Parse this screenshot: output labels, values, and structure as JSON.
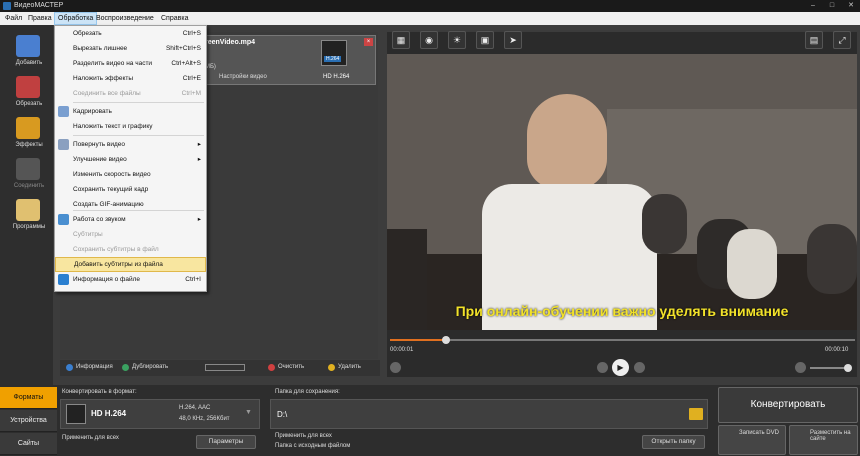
{
  "title": "ВидеоМАСТЕР",
  "menu": [
    "Файл",
    "Правка",
    "Обработка",
    "Воспроизведение",
    "Справка"
  ],
  "sidebar": [
    "Добавить",
    "Обрезать",
    "Эффекты",
    "Соединить",
    "Программы"
  ],
  "dropdown": [
    {
      "label": "Обрезать",
      "shortcut": "Ctrl+S",
      "disabled": false
    },
    {
      "label": "Вырезать лишнее",
      "shortcut": "Shift+Ctrl+S",
      "disabled": false
    },
    {
      "label": "Разделить видео на части",
      "shortcut": "Ctrl+Alt+S",
      "disabled": false
    },
    {
      "label": "Наложить эффекты",
      "shortcut": "Ctrl+E",
      "disabled": false
    },
    {
      "label": "Соединить все файлы",
      "shortcut": "Ctrl+M",
      "disabled": true
    },
    {
      "label": "Кадрировать",
      "shortcut": "",
      "disabled": false
    },
    {
      "label": "Наложить текст и графику",
      "shortcut": "",
      "disabled": false
    },
    {
      "label": "Повернуть видео",
      "shortcut": "",
      "disabled": false,
      "submenu": true
    },
    {
      "label": "Улучшение видео",
      "shortcut": "",
      "disabled": false,
      "submenu": true
    },
    {
      "label": "Изменить скорость видео",
      "shortcut": "",
      "disabled": false
    },
    {
      "label": "Сохранить текущий кадр",
      "shortcut": "",
      "disabled": false
    },
    {
      "label": "Создать GIF-анимацию",
      "shortcut": "",
      "disabled": false
    },
    {
      "label": "Работа со звуком",
      "shortcut": "",
      "disabled": false,
      "submenu": true
    },
    {
      "label": "Субтитры",
      "shortcut": "",
      "disabled": true
    },
    {
      "label": "Сохранить субтитры в файл",
      "shortcut": "",
      "disabled": true
    },
    {
      "label": "Добавить субтитры из файла",
      "shortcut": "",
      "disabled": false,
      "highlighted": true
    },
    {
      "label": "Информация о файле",
      "shortcut": "Ctrl+I",
      "disabled": false
    }
  ],
  "file": {
    "name": "reenVideo.mp4",
    "badge": "H.264",
    "format": "HD H.264",
    "size": "МБ)",
    "settings": "Настройки видео"
  },
  "tools": {
    "info": "Информация",
    "duplicate": "Дублировать",
    "clear": "Очистить",
    "delete": "Удалить"
  },
  "player": {
    "subtitle": "При онлайн-обучении важно уделять внимание",
    "time_start": "00:00:01",
    "time_end": "00:00:10",
    "progress": 0.12
  },
  "bottom": {
    "tabs": [
      "Форматы",
      "Устройства",
      "Сайты"
    ],
    "convert_to": "Конвертировать в формат:",
    "format_name": "HD H.264",
    "format_codec": "H.264, AAC",
    "format_audio": "48,0 КHz, 256Кбит",
    "apply_all": "Применить для всех",
    "params": "Параметры",
    "save_folder": "Папка для сохранения:",
    "path": "D:\\",
    "apply_all2": "Применить для всех",
    "source_folder": "Папка с исходным файлом",
    "open_folder": "Открыть папку",
    "convert": "Конвертировать",
    "dvd": "Записать DVD",
    "site": "Разместить на сайте"
  }
}
